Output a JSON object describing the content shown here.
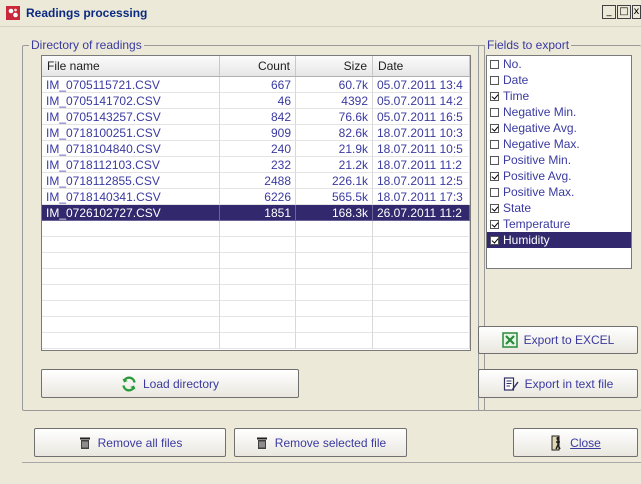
{
  "window": {
    "title": "Readings processing",
    "min_label": "_",
    "max_label": "□",
    "close_label": "x"
  },
  "directory": {
    "label": "Directory of readings",
    "columns": [
      "File name",
      "Count",
      "Size",
      "Date"
    ],
    "rows": [
      {
        "name": "IM_0705115721.CSV",
        "count": "667",
        "size": "60.7k",
        "date": "05.07.2011 13:4",
        "selected": false
      },
      {
        "name": "IM_0705141702.CSV",
        "count": "46",
        "size": "4392",
        "date": "05.07.2011 14:2",
        "selected": false
      },
      {
        "name": "IM_0705143257.CSV",
        "count": "842",
        "size": "76.6k",
        "date": "05.07.2011 16:5",
        "selected": false
      },
      {
        "name": "IM_0718100251.CSV",
        "count": "909",
        "size": "82.6k",
        "date": "18.07.2011 10:3",
        "selected": false
      },
      {
        "name": "IM_0718104840.CSV",
        "count": "240",
        "size": "21.9k",
        "date": "18.07.2011 10:5",
        "selected": false
      },
      {
        "name": "IM_0718112103.CSV",
        "count": "232",
        "size": "21.2k",
        "date": "18.07.2011 11:2",
        "selected": false
      },
      {
        "name": "IM_0718112855.CSV",
        "count": "2488",
        "size": "226.1k",
        "date": "18.07.2011 12:5",
        "selected": false
      },
      {
        "name": "IM_0718140341.CSV",
        "count": "6226",
        "size": "565.5k",
        "date": "18.07.2011 17:3",
        "selected": false
      },
      {
        "name": "IM_0726102727.CSV",
        "count": "1851",
        "size": "168.3k",
        "date": "26.07.2011 11:2",
        "selected": true
      }
    ],
    "load_button": "Load directory"
  },
  "fields": {
    "label": "Fields to export",
    "items": [
      {
        "label": "No.",
        "checked": false,
        "selected": false
      },
      {
        "label": "Date",
        "checked": false,
        "selected": false
      },
      {
        "label": "Time",
        "checked": true,
        "selected": false
      },
      {
        "label": "Negative Min.",
        "checked": false,
        "selected": false
      },
      {
        "label": "Negative Avg.",
        "checked": true,
        "selected": false
      },
      {
        "label": "Negative Max.",
        "checked": false,
        "selected": false
      },
      {
        "label": "Positive Min.",
        "checked": false,
        "selected": false
      },
      {
        "label": "Positive Avg.",
        "checked": true,
        "selected": false
      },
      {
        "label": "Positive Max.",
        "checked": false,
        "selected": false
      },
      {
        "label": "State",
        "checked": true,
        "selected": false
      },
      {
        "label": "Temperature",
        "checked": true,
        "selected": false
      },
      {
        "label": "Humidity",
        "checked": true,
        "selected": true
      }
    ]
  },
  "actions": {
    "export_excel": "Export to EXCEL",
    "export_text": "Export in text file",
    "remove_all": "Remove all files",
    "remove_selected": "Remove selected file",
    "close": "Close"
  },
  "colors": {
    "selection": "#32286e",
    "text": "#3a3aa0",
    "background": "#ece9d8"
  }
}
